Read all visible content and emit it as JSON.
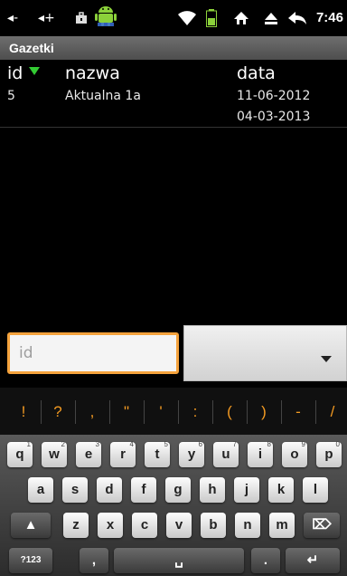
{
  "status_bar": {
    "time": "7:46",
    "icons": [
      "signal-minus-icon",
      "signal-plus-icon",
      "briefcase-icon",
      "android-icon",
      "wifi-icon",
      "battery-icon",
      "home-icon",
      "eject-icon",
      "back-arrow-icon"
    ]
  },
  "title": "Gazetki",
  "table": {
    "headers": {
      "id": "id",
      "name": "nazwa",
      "date": "data"
    },
    "rows": [
      {
        "id": "5",
        "name": "Aktualna  1a",
        "date": "11-06-2012"
      },
      {
        "id": "",
        "name": "",
        "date": "04-03-2013"
      }
    ]
  },
  "form": {
    "id_placeholder": "id",
    "spinner_value": ""
  },
  "keyboard": {
    "suggestions": [
      "!",
      "?",
      ",",
      "\"",
      "'",
      ":",
      "(",
      ")",
      "-",
      "/"
    ],
    "row1": [
      {
        "k": "q",
        "s": "1"
      },
      {
        "k": "w",
        "s": "2"
      },
      {
        "k": "e",
        "s": "3"
      },
      {
        "k": "r",
        "s": "4"
      },
      {
        "k": "t",
        "s": "5"
      },
      {
        "k": "y",
        "s": "6"
      },
      {
        "k": "u",
        "s": "7"
      },
      {
        "k": "i",
        "s": "8"
      },
      {
        "k": "o",
        "s": "9"
      },
      {
        "k": "p",
        "s": "0"
      }
    ],
    "row2": [
      "a",
      "s",
      "d",
      "f",
      "g",
      "h",
      "j",
      "k",
      "l"
    ],
    "row3": [
      "z",
      "x",
      "c",
      "v",
      "b",
      "n",
      "m"
    ],
    "numbers_label": "?123",
    "comma": ",",
    "period": "."
  }
}
